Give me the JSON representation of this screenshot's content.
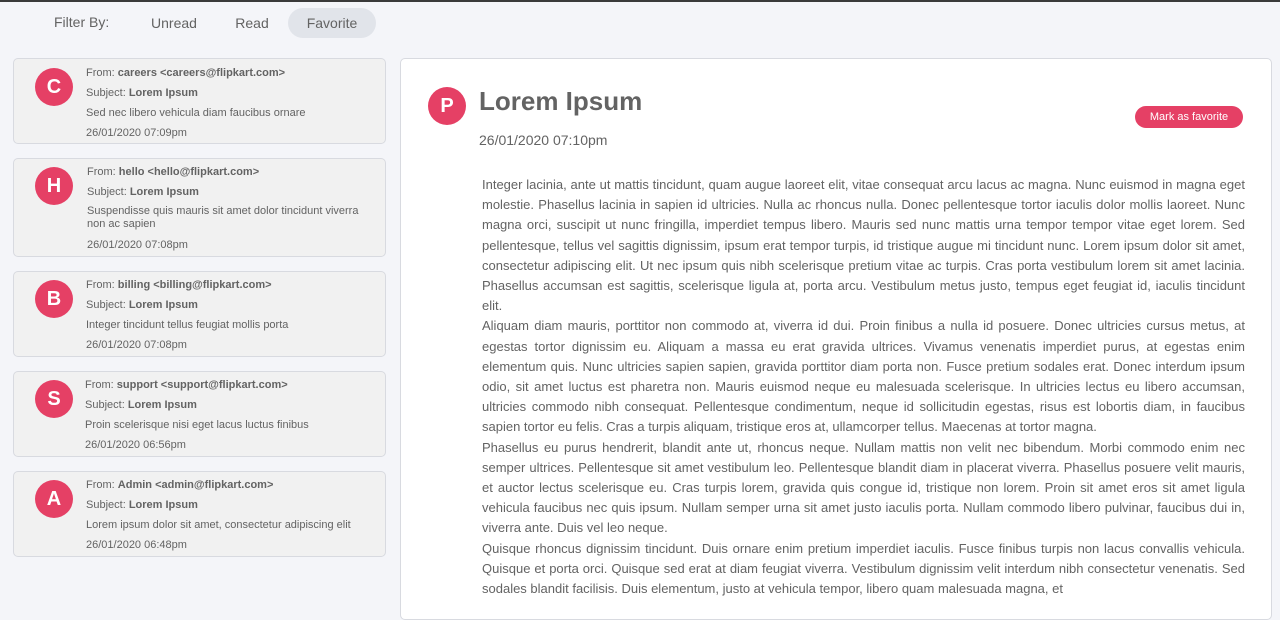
{
  "filter": {
    "label": "Filter By:",
    "options": [
      "Unread",
      "Read",
      "Favorite"
    ],
    "active": "Favorite"
  },
  "emails": [
    {
      "initial": "C",
      "from_label": "From:",
      "from": "careers <careers@flipkart.com>",
      "subject_label": "Subject:",
      "subject": "Lorem Ipsum",
      "description": "Sed nec libero vehicula diam faucibus ornare",
      "date": "26/01/2020 07:09pm"
    },
    {
      "initial": "H",
      "from_label": "From:",
      "from": "hello <hello@flipkart.com>",
      "subject_label": "Subject:",
      "subject": "Lorem Ipsum",
      "description": "Suspendisse quis mauris sit amet dolor tincidunt viverra non ac sapien",
      "date": "26/01/2020 07:08pm"
    },
    {
      "initial": "B",
      "from_label": "From:",
      "from": "billing <billing@flipkart.com>",
      "subject_label": "Subject:",
      "subject": "Lorem Ipsum",
      "description": "Integer tincidunt tellus feugiat mollis porta",
      "date": "26/01/2020 07:08pm"
    },
    {
      "initial": "S",
      "from_label": "From:",
      "from": "support <support@flipkart.com>",
      "subject_label": "Subject:",
      "subject": "Lorem Ipsum",
      "description": "Proin scelerisque nisi eget lacus luctus finibus",
      "date": "26/01/2020 06:56pm"
    },
    {
      "initial": "A",
      "from_label": "From:",
      "from": "Admin <admin@flipkart.com>",
      "subject_label": "Subject:",
      "subject": "Lorem Ipsum",
      "description": "Lorem ipsum dolor sit amet, consectetur adipiscing elit",
      "date": "26/01/2020 06:48pm"
    }
  ],
  "reader": {
    "initial": "P",
    "subject": "Lorem Ipsum",
    "date": "26/01/2020 07:10pm",
    "favorite_button": "Mark as favorite",
    "paragraphs": [
      "Integer lacinia, ante ut mattis tincidunt, quam augue laoreet elit, vitae consequat arcu lacus ac magna. Nunc euismod in magna eget molestie. Phasellus lacinia in sapien id ultricies. Nulla ac rhoncus nulla. Donec pellentesque tortor iaculis dolor mollis laoreet. Nunc magna orci, suscipit ut nunc fringilla, imperdiet tempus libero. Mauris sed nunc mattis urna tempor tempor vitae eget lorem. Sed pellentesque, tellus vel sagittis dignissim, ipsum erat tempor turpis, id tristique augue mi tincidunt nunc. Lorem ipsum dolor sit amet, consectetur adipiscing elit. Ut nec ipsum quis nibh scelerisque pretium vitae ac turpis. Cras porta vestibulum lorem sit amet lacinia. Phasellus accumsan est sagittis, scelerisque ligula at, porta arcu. Vestibulum metus justo, tempus eget feugiat id, iaculis tincidunt elit.",
      "Aliquam diam mauris, porttitor non commodo at, viverra id dui. Proin finibus a nulla id posuere. Donec ultricies cursus metus, at egestas tortor dignissim eu. Aliquam a massa eu erat gravida ultrices. Vivamus venenatis imperdiet purus, at egestas enim elementum quis. Nunc ultricies sapien sapien, gravida porttitor diam porta non. Fusce pretium sodales erat. Donec interdum ipsum odio, sit amet luctus est pharetra non. Mauris euismod neque eu malesuada scelerisque. In ultricies lectus eu libero accumsan, ultricies commodo nibh consequat. Pellentesque condimentum, neque id sollicitudin egestas, risus est lobortis diam, in faucibus sapien tortor eu felis. Cras a turpis aliquam, tristique eros at, ullamcorper tellus. Maecenas at tortor magna.",
      "Phasellus eu purus hendrerit, blandit ante ut, rhoncus neque. Nullam mattis non velit nec bibendum. Morbi commodo enim nec semper ultrices. Pellentesque sit amet vestibulum leo. Pellentesque blandit diam in placerat viverra. Phasellus posuere velit mauris, et auctor lectus scelerisque eu. Cras turpis lorem, gravida quis congue id, tristique non lorem. Proin sit amet eros sit amet ligula vehicula faucibus nec quis ipsum. Nullam semper urna sit amet justo iaculis porta. Nullam commodo libero pulvinar, faucibus dui in, viverra ante. Duis vel leo neque.",
      "Quisque rhoncus dignissim tincidunt. Duis ornare enim pretium imperdiet iaculis. Fusce finibus turpis non lacus convallis vehicula. Quisque et porta orci. Quisque sed erat at diam feugiat viverra. Vestibulum dignissim velit interdum nibh consectetur venenatis. Sed sodales blandit facilisis. Duis elementum, justo at vehicula tempor, libero quam malesuada magna, et"
    ]
  },
  "colors": {
    "accent": "#e54065",
    "text": "#636363",
    "background": "#f4f5f9",
    "card": "#f1f1f1",
    "border": "#d8dae0",
    "filter_active": "#e1e4ea"
  }
}
